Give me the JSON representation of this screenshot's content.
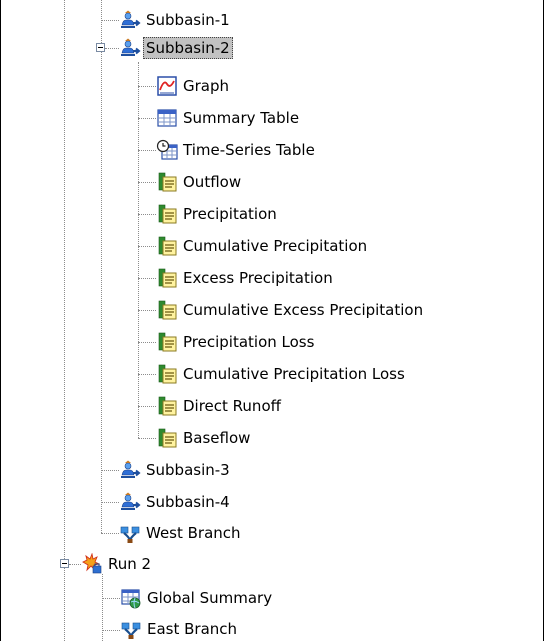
{
  "tree": {
    "subbasin_1": "Subbasin-1",
    "subbasin_2": {
      "label": "Subbasin-2",
      "selected": true,
      "children": {
        "graph": "Graph",
        "summary_table": "Summary Table",
        "time_series_table": "Time-Series Table",
        "outflow": "Outflow",
        "precipitation": "Precipitation",
        "cumulative_precipitation": "Cumulative Precipitation",
        "excess_precipitation": "Excess Precipitation",
        "cumulative_excess_precipitation": "Cumulative Excess Precipitation",
        "precipitation_loss": "Precipitation Loss",
        "cumulative_precipitation_loss": "Cumulative Precipitation Loss",
        "direct_runoff": "Direct Runoff",
        "baseflow": "Baseflow"
      }
    },
    "subbasin_3": "Subbasin-3",
    "subbasin_4": "Subbasin-4",
    "west_branch": "West Branch",
    "run_2": {
      "label": "Run 2",
      "children": {
        "global_summary": "Global Summary",
        "east_branch": "East Branch"
      }
    }
  },
  "icons": {
    "subbasin": "subbasin-icon",
    "graph": "graph-icon",
    "summary_table": "table-icon",
    "time_series_table": "time-series-table-icon",
    "result_item": "result-sheet-icon",
    "junction": "junction-icon",
    "run": "run-icon",
    "global_summary": "global-summary-icon"
  },
  "colors": {
    "selection": "#c2c2c2",
    "tree_lines": "#8c8c8c"
  }
}
